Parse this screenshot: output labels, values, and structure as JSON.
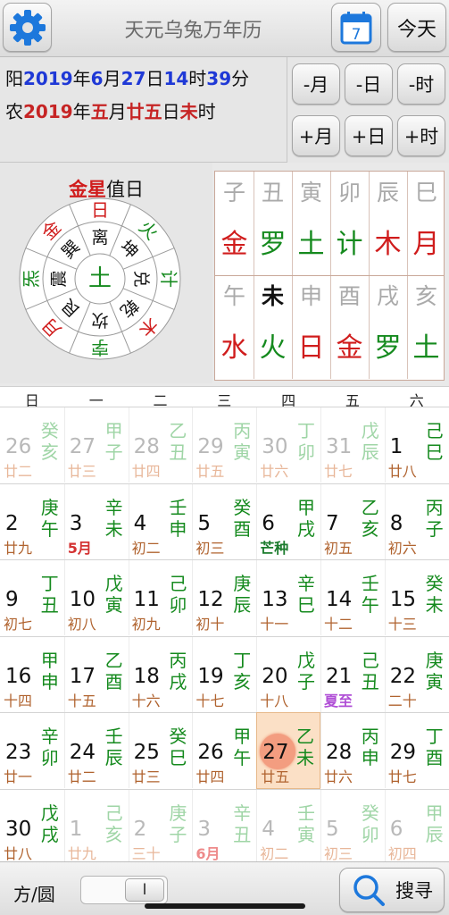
{
  "toolbar": {
    "settings_icon": "gear-icon",
    "title": "天元乌兔万年历",
    "calendar_day": "7",
    "today_label": "今天"
  },
  "info": {
    "solar": {
      "prefix": "阳",
      "year": "2019",
      "year_unit": "年",
      "month": "6",
      "month_unit": "月",
      "day": "27",
      "day_unit": "日",
      "hour": "14",
      "hour_unit": "时",
      "minute": "39",
      "minute_unit": "分"
    },
    "lunar": {
      "prefix": "农",
      "year": "2019",
      "year_unit": "年",
      "month": "五",
      "month_unit": "月",
      "day": "廿五",
      "day_unit": "日",
      "hour": "未",
      "hour_unit": "时"
    }
  },
  "nav": {
    "minus_month": "-月",
    "minus_day": "-日",
    "minus_hour": "-时",
    "plus_month": "+月",
    "plus_day": "+日",
    "plus_hour": "+时"
  },
  "duty_star": {
    "star": "金星",
    "suffix": "值日"
  },
  "wheel": {
    "center": "土",
    "outer": [
      "日",
      "火",
      "计",
      "木",
      "孛",
      "月",
      "炁",
      "金"
    ],
    "inner": [
      "离",
      "坤",
      "兑",
      "乾",
      "坎",
      "艮",
      "震",
      "巽"
    ],
    "outer_colors": [
      "#d01c1c",
      "#158a1e",
      "#158a1e",
      "#d01c1c",
      "#158a1e",
      "#d01c1c",
      "#158a1e",
      "#d01c1c"
    ]
  },
  "hour_grid": {
    "branches": [
      "子",
      "丑",
      "寅",
      "卯",
      "辰",
      "巳",
      "午",
      "未",
      "申",
      "酉",
      "戌",
      "亥"
    ],
    "stars": [
      "金",
      "罗",
      "土",
      "计",
      "木",
      "月",
      "水",
      "火",
      "日",
      "金",
      "罗",
      "土"
    ],
    "star_colors": [
      "#d01c1c",
      "#158a1e",
      "#158a1e",
      "#158a1e",
      "#d01c1c",
      "#d01c1c",
      "#d01c1c",
      "#158a1e",
      "#d01c1c",
      "#d01c1c",
      "#158a1e",
      "#158a1e"
    ],
    "current_index": 7
  },
  "weekdays": [
    "日",
    "一",
    "二",
    "三",
    "四",
    "五",
    "六"
  ],
  "days": [
    {
      "d": "26",
      "gz": "癸亥",
      "lunar": "廿二",
      "faded": true
    },
    {
      "d": "27",
      "gz": "甲子",
      "lunar": "廿三",
      "faded": true
    },
    {
      "d": "28",
      "gz": "乙丑",
      "lunar": "廿四",
      "faded": true
    },
    {
      "d": "29",
      "gz": "丙寅",
      "lunar": "廿五",
      "faded": true
    },
    {
      "d": "30",
      "gz": "丁卯",
      "lunar": "廿六",
      "faded": true
    },
    {
      "d": "31",
      "gz": "戊辰",
      "lunar": "廿七",
      "faded": true
    },
    {
      "d": "1",
      "gz": "己巳",
      "lunar": "廿八"
    },
    {
      "d": "2",
      "gz": "庚午",
      "lunar": "廿九"
    },
    {
      "d": "3",
      "gz": "辛未",
      "lunar": "5月",
      "kind": "month"
    },
    {
      "d": "4",
      "gz": "壬申",
      "lunar": "初二"
    },
    {
      "d": "5",
      "gz": "癸酉",
      "lunar": "初三"
    },
    {
      "d": "6",
      "gz": "甲戌",
      "lunar": "芒种",
      "kind": "term"
    },
    {
      "d": "7",
      "gz": "乙亥",
      "lunar": "初五"
    },
    {
      "d": "8",
      "gz": "丙子",
      "lunar": "初六"
    },
    {
      "d": "9",
      "gz": "丁丑",
      "lunar": "初七"
    },
    {
      "d": "10",
      "gz": "戊寅",
      "lunar": "初八"
    },
    {
      "d": "11",
      "gz": "己卯",
      "lunar": "初九"
    },
    {
      "d": "12",
      "gz": "庚辰",
      "lunar": "初十"
    },
    {
      "d": "13",
      "gz": "辛巳",
      "lunar": "十一"
    },
    {
      "d": "14",
      "gz": "壬午",
      "lunar": "十二"
    },
    {
      "d": "15",
      "gz": "癸未",
      "lunar": "十三"
    },
    {
      "d": "16",
      "gz": "甲申",
      "lunar": "十四"
    },
    {
      "d": "17",
      "gz": "乙酉",
      "lunar": "十五"
    },
    {
      "d": "18",
      "gz": "丙戌",
      "lunar": "十六"
    },
    {
      "d": "19",
      "gz": "丁亥",
      "lunar": "十七"
    },
    {
      "d": "20",
      "gz": "戊子",
      "lunar": "十八"
    },
    {
      "d": "21",
      "gz": "己丑",
      "lunar": "夏至",
      "kind": "term2"
    },
    {
      "d": "22",
      "gz": "庚寅",
      "lunar": "二十"
    },
    {
      "d": "23",
      "gz": "辛卯",
      "lunar": "廿一"
    },
    {
      "d": "24",
      "gz": "壬辰",
      "lunar": "廿二"
    },
    {
      "d": "25",
      "gz": "癸巳",
      "lunar": "廿三"
    },
    {
      "d": "26",
      "gz": "甲午",
      "lunar": "廿四"
    },
    {
      "d": "27",
      "gz": "乙未",
      "lunar": "廿五",
      "selected": true
    },
    {
      "d": "28",
      "gz": "丙申",
      "lunar": "廿六"
    },
    {
      "d": "29",
      "gz": "丁酉",
      "lunar": "廿七"
    },
    {
      "d": "30",
      "gz": "戊戌",
      "lunar": "廿八"
    },
    {
      "d": "1",
      "gz": "己亥",
      "lunar": "廿九",
      "faded": true
    },
    {
      "d": "2",
      "gz": "庚子",
      "lunar": "三十",
      "faded": true
    },
    {
      "d": "3",
      "gz": "辛丑",
      "lunar": "6月",
      "kind": "month",
      "faded": true
    },
    {
      "d": "4",
      "gz": "壬寅",
      "lunar": "初二",
      "faded": true
    },
    {
      "d": "5",
      "gz": "癸卯",
      "lunar": "初三",
      "faded": true
    },
    {
      "d": "6",
      "gz": "甲辰",
      "lunar": "初四",
      "faded": true
    }
  ],
  "bottom": {
    "mode_label": "方/圆",
    "toggle_label": "I",
    "search_icon": "search-icon",
    "search_label": "搜寻"
  }
}
